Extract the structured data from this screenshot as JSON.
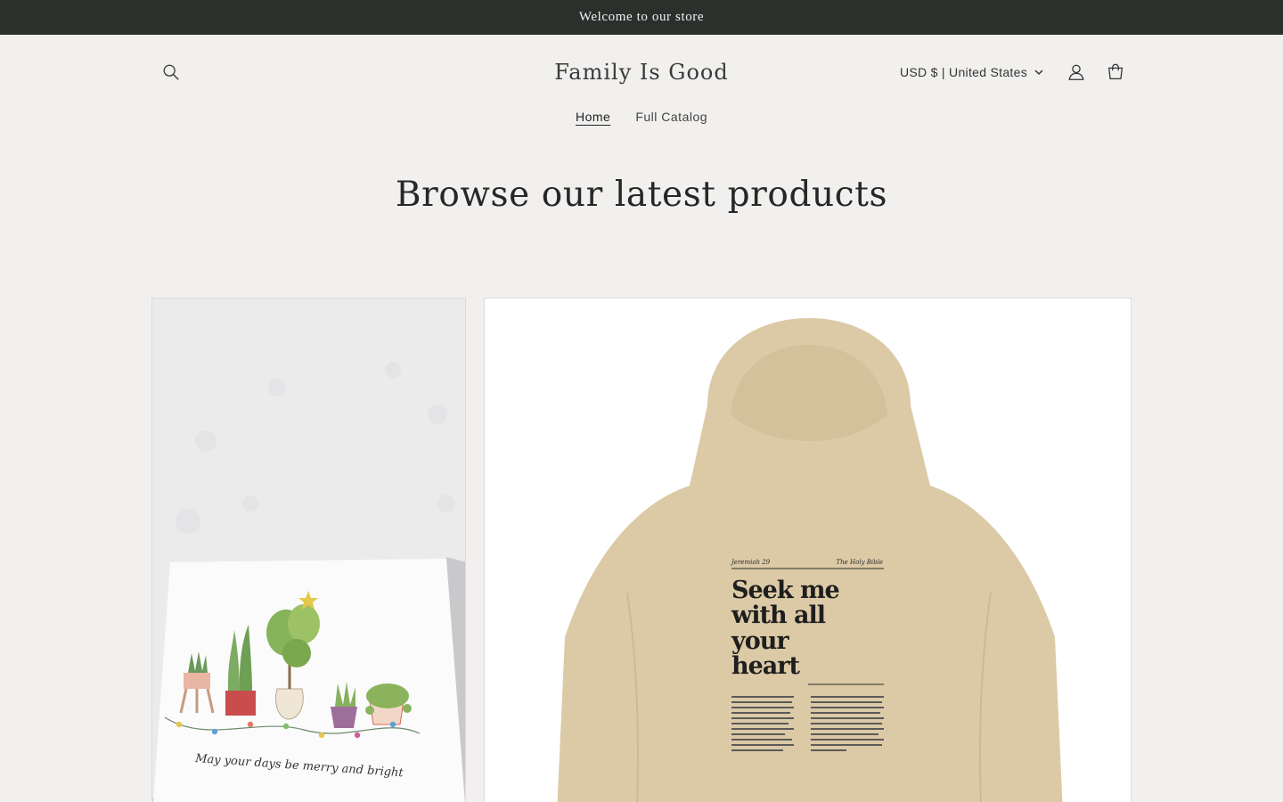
{
  "announcement": {
    "text": "Welcome to our store"
  },
  "header": {
    "logo": "Family Is Good",
    "currency_selector": "USD $ | United States",
    "icons": {
      "search": "search-icon",
      "account": "account-icon",
      "cart": "cart-icon"
    }
  },
  "nav": {
    "items": [
      {
        "label": "Home",
        "active": true
      },
      {
        "label": "Full Catalog",
        "active": false
      }
    ]
  },
  "main": {
    "section_title": "Browse our latest products",
    "products": [
      {
        "image_card_text": "May your days be merry and bright"
      },
      {
        "image_print": {
          "ref": "Jeremiah 29",
          "source": "The Holy Bible",
          "headline": [
            "Seek me",
            "with all",
            "your",
            "heart"
          ]
        }
      }
    ]
  },
  "colors": {
    "announcement_bg": "#2c302d",
    "page_bg": "#f1f0ee",
    "hoodie": "#dccaa6"
  }
}
